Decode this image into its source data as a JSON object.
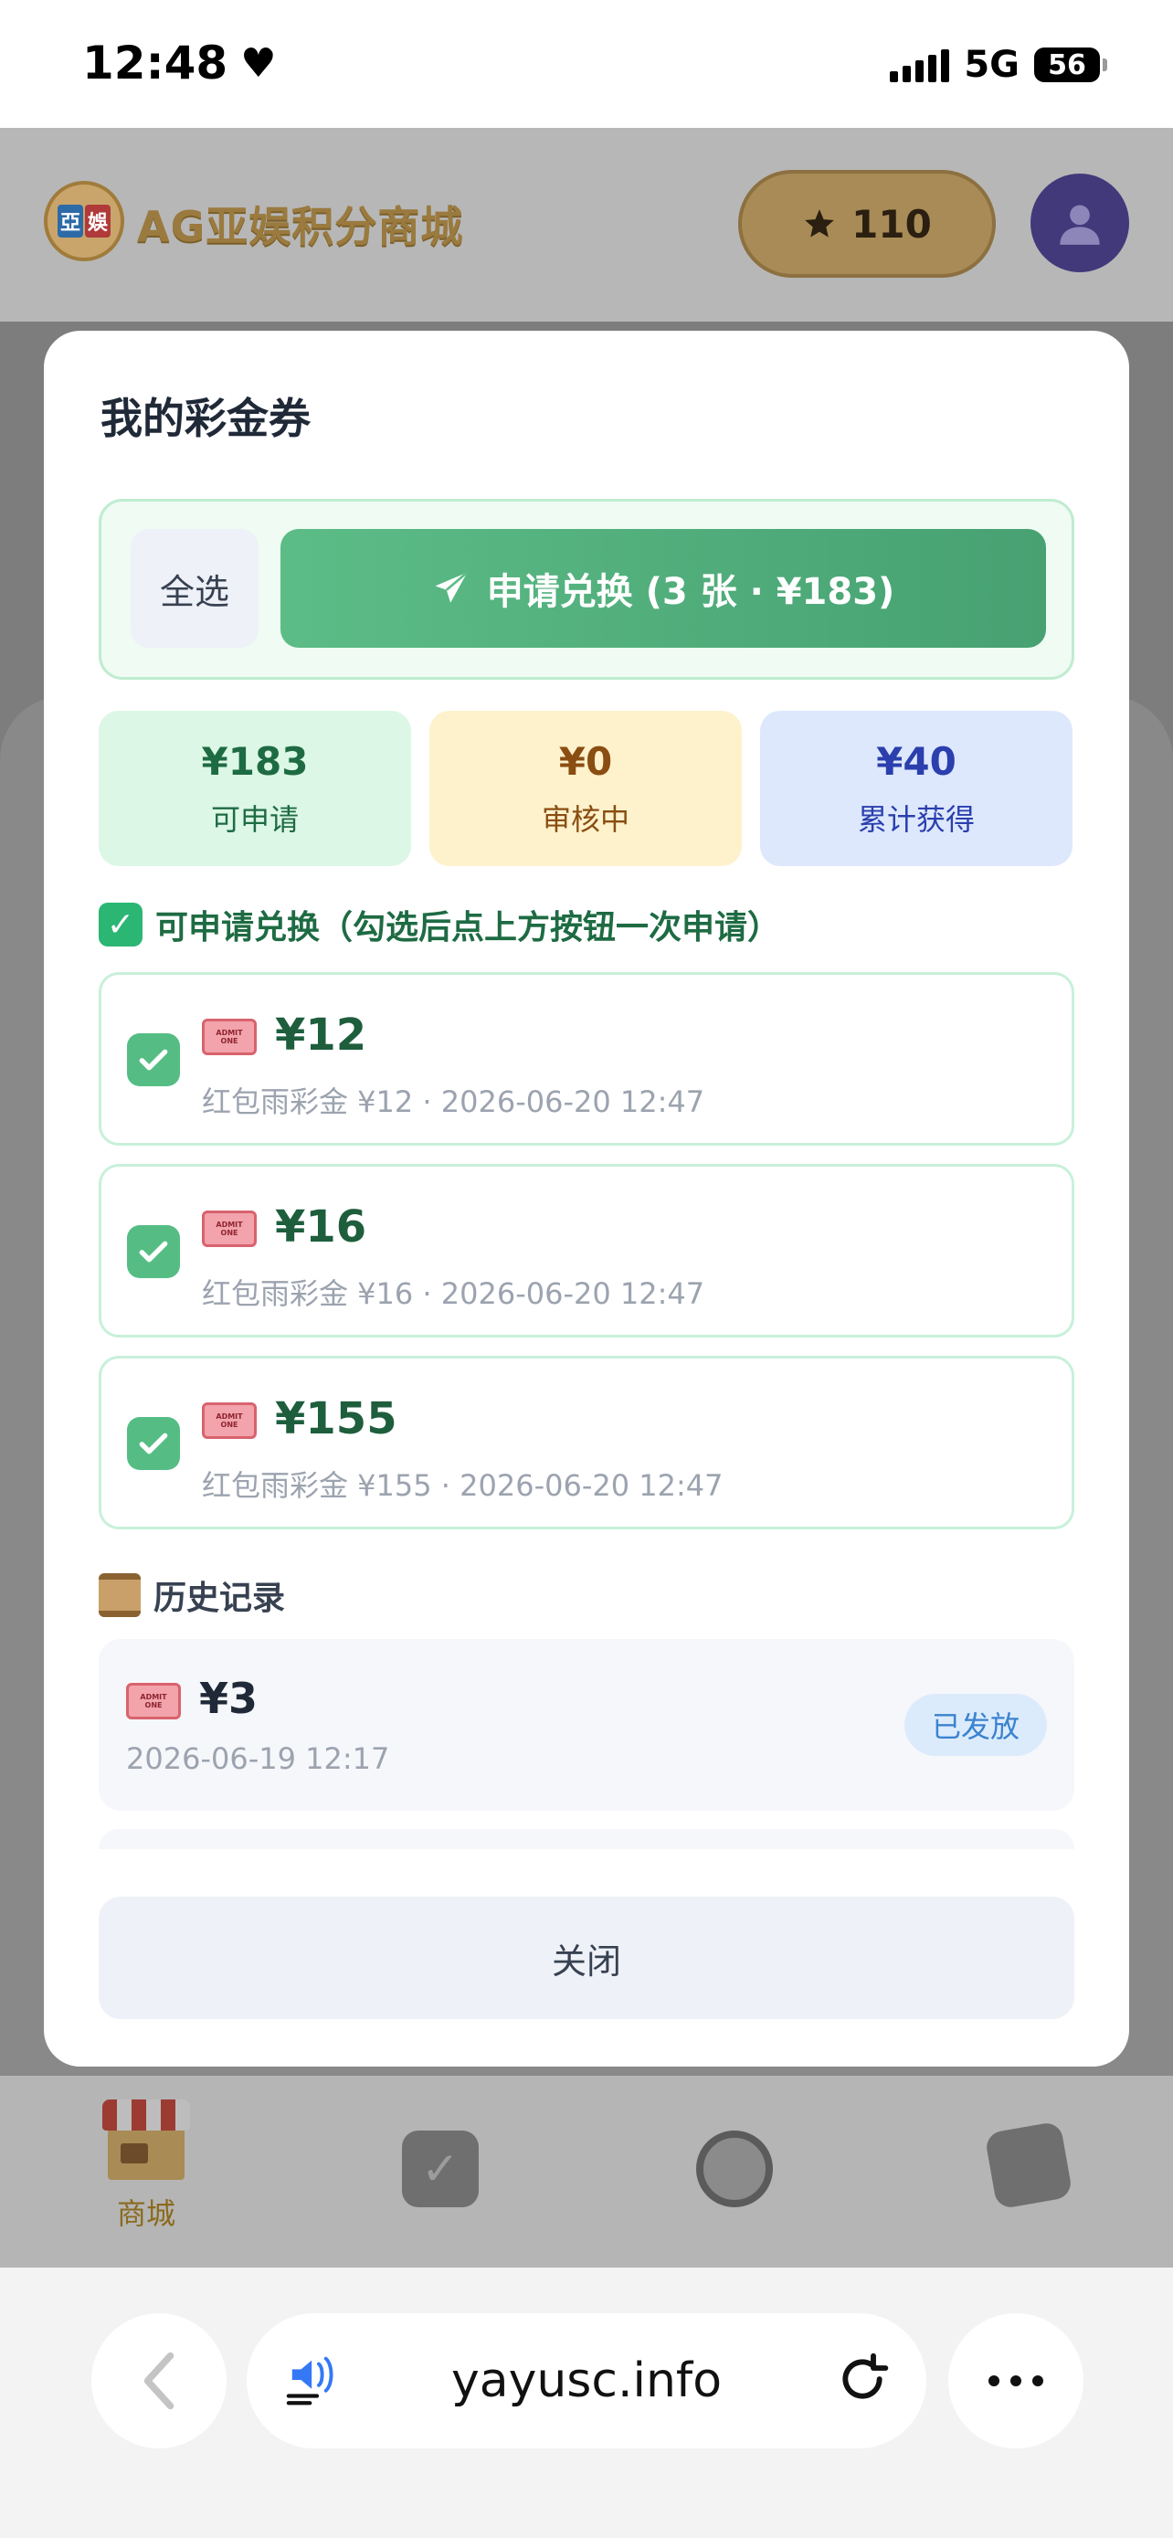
{
  "status_bar": {
    "time": "12:48",
    "network": "5G",
    "battery": "56"
  },
  "app": {
    "logo_chars": [
      "亞",
      "娛"
    ],
    "title": "AG亚娱积分商城",
    "points": "110",
    "tabs": [
      {
        "label": "商城",
        "icon": "shop-icon"
      },
      {
        "label": "",
        "icon": "calendar-icon"
      },
      {
        "label": "",
        "icon": "wheel-icon"
      },
      {
        "label": "",
        "icon": "card-icon"
      }
    ]
  },
  "modal": {
    "title": "我的彩金券",
    "select_all_label": "全选",
    "apply_label": "申请兑换 (3 张 · ¥183)",
    "stats": [
      {
        "value": "¥183",
        "label": "可申请",
        "color": "#1e6b43"
      },
      {
        "value": "¥0",
        "label": "审核中",
        "color": "#8a4d12"
      },
      {
        "value": "¥40",
        "label": "累计获得",
        "color": "#2b3fae"
      }
    ],
    "available_section_title": "可申请兑换（勾选后点上方按钮一次申请）",
    "coupons": [
      {
        "amount": "¥12",
        "subtitle": "红包雨彩金 ¥12 · 2026-06-20 12:47",
        "checked": true
      },
      {
        "amount": "¥16",
        "subtitle": "红包雨彩金 ¥16 · 2026-06-20 12:47",
        "checked": true
      },
      {
        "amount": "¥155",
        "subtitle": "红包雨彩金 ¥155 · 2026-06-20 12:47",
        "checked": true
      }
    ],
    "history_section_title": "历史记录",
    "history": [
      {
        "amount": "¥3",
        "date": "2026-06-19 12:17",
        "status": "已发放"
      }
    ],
    "close_label": "关闭"
  },
  "browser": {
    "domain": "yayusc.info"
  },
  "colors": {
    "accent_green": "#4fae7b",
    "badge_blue": "#3a83cf",
    "gold": "#a88b56"
  }
}
